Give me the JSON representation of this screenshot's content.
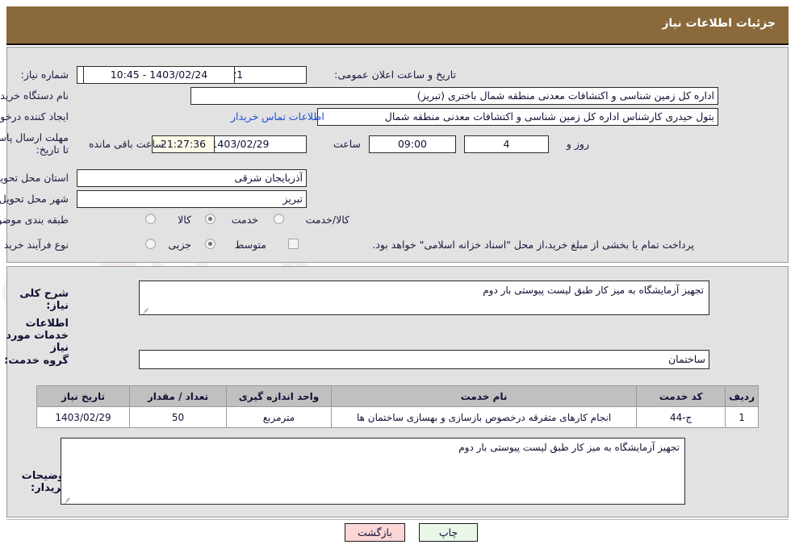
{
  "header": {
    "title": "جزئیات اطلاعات نیاز"
  },
  "top_form": {
    "need_number_label": "شماره نیاز:",
    "need_number_value": "1103030735000021",
    "announce_label": "تاریخ و ساعت اعلان عمومی:",
    "announce_value": "10:45 - 1403/02/24",
    "buyer_org_label": "نام دستگاه خریدار:",
    "buyer_org_value": "اداره کل زمین شناسی و اکتشافات معدنی منطقه شمال باختری (تبریز)",
    "creator_label": "ایجاد کننده درخواست:",
    "creator_value": "بتول  حیدری کارشناس اداره کل زمین شناسی و اکتشافات معدنی منطقه شمال",
    "contact_link": "اطلاعات تماس خریدار",
    "deadline_label": "مهلت ارسال پاسخ: تا تاریخ:",
    "deadline_date": "1403/02/29",
    "hour_label": "ساعت",
    "deadline_time": "09:00",
    "days_value": "4",
    "days_label": "روز و",
    "remaining_time": "21:27:36",
    "remaining_label": "ساعت باقی مانده",
    "province_label": "استان محل تحویل:",
    "province_value": "آذربایجان شرقی",
    "city_label": "شهر محل تحویل:",
    "city_value": "تبریز",
    "category_label": "طبقه بندی موضوعی:",
    "category_options": [
      {
        "label": "کالا",
        "selected": false
      },
      {
        "label": "خدمت",
        "selected": true
      },
      {
        "label": "کالا/خدمت",
        "selected": false
      }
    ],
    "process_label": "نوع فرآیند خرید :",
    "process_options": [
      {
        "label": "جزیی",
        "selected": false
      },
      {
        "label": "متوسط",
        "selected": true
      }
    ],
    "treasury_checkbox_checked": false,
    "treasury_note": "پرداخت تمام یا بخشی از مبلغ خرید،از محل \"اسناد خزانه اسلامی\" خواهد بود."
  },
  "middle": {
    "summary_label": "شرح کلی نیاز:",
    "summary_value": "تجهیز آزمایشگاه به میز کار طبق لیست پیوستی بار دوم",
    "services_heading": "اطلاعات خدمات مورد نیاز",
    "service_group_label": "گروه خدمت:",
    "service_group_value": "ساختمان",
    "table": {
      "columns": [
        "ردیف",
        "کد خدمت",
        "نام خدمت",
        "واحد اندازه گیری",
        "تعداد / مقدار",
        "تاریخ نیاز"
      ],
      "rows": [
        {
          "row": "1",
          "code": "ج-44",
          "name": "انجام کارهای متفرقه درخصوص بازسازی و بهسازی ساختمان ها",
          "unit": "مترمربع",
          "qty": "50",
          "date": "1403/02/29"
        }
      ]
    },
    "buyer_notes_label": "توضیحات خریدار:",
    "buyer_notes_value": "تجهیز آزمایشگاه به میز کار طبق لیست پیوستی بار دوم"
  },
  "footer": {
    "print_label": "چاپ",
    "back_label": "بازگشت"
  },
  "watermark": {
    "text": "AnaTender.net"
  },
  "colors": {
    "header_bg": "#8a6a3a",
    "panel_bg": "#e2e2e2",
    "link": "#1d4ed8",
    "table_header": "#c0c0c0",
    "print_btn": "#e9f7e9",
    "back_btn": "#fbd6d6",
    "countdown_bg": "#fdfae6"
  }
}
